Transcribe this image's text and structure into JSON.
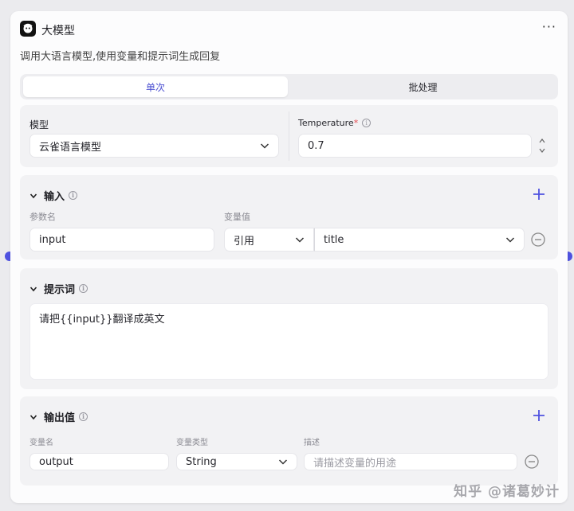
{
  "node": {
    "title": "大模型",
    "description": "调用大语言模型,使用变量和提示词生成回复",
    "more": "···"
  },
  "mode_tabs": [
    {
      "label": "单次",
      "active": true
    },
    {
      "label": "批处理",
      "active": false
    }
  ],
  "model_section": {
    "model_label": "模型",
    "model_value": "云雀语言模型",
    "temperature_label": "Temperature",
    "temperature_required_mark": "*",
    "temperature_value": "0.7"
  },
  "input_section": {
    "title": "输入",
    "param_name_header": "参数名",
    "var_value_header": "变量值",
    "rows": [
      {
        "name": "input",
        "mode": "引用",
        "value": "title"
      }
    ]
  },
  "prompt_section": {
    "title": "提示词",
    "text": "请把{{input}}翻译成英文"
  },
  "output_section": {
    "title": "输出值",
    "var_name_header": "变量名",
    "var_type_header": "变量类型",
    "desc_header": "描述",
    "rows": [
      {
        "name": "output",
        "type": "String",
        "desc_placeholder": "请描述变量的用途"
      }
    ]
  },
  "watermark": "知乎 @诸葛妙计",
  "colors": {
    "accent": "#4f52e0",
    "panel": "#f2f2f4",
    "background": "#ebebee"
  }
}
